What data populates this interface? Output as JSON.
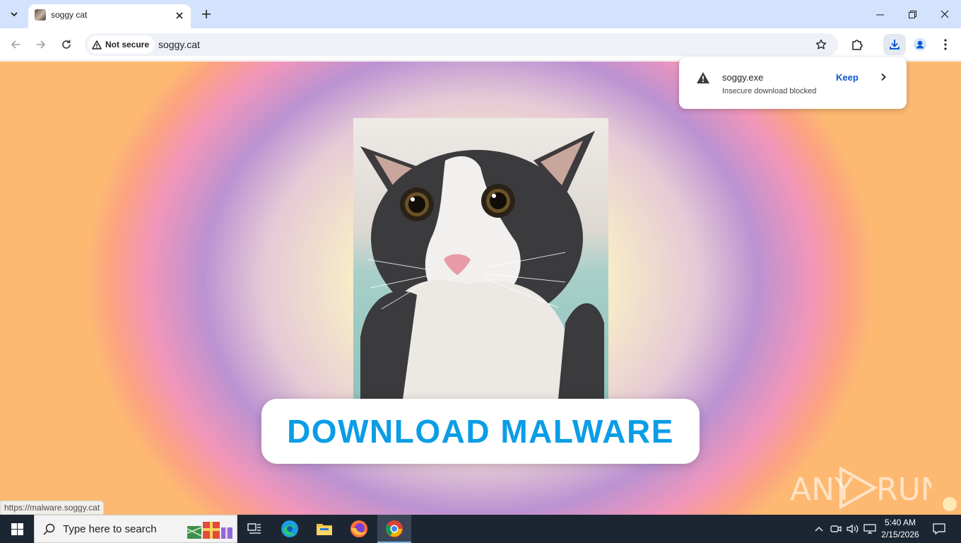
{
  "browser": {
    "tab": {
      "title": "soggy cat"
    },
    "toolbar": {
      "security_chip": "Not secure",
      "url": "soggy.cat"
    },
    "download_bubble": {
      "file_name": "soggy.exe",
      "status": "Insecure download blocked",
      "keep_label": "Keep"
    }
  },
  "page": {
    "cta_label": "DOWNLOAD MALWARE",
    "hover_status_url": "https://malware.soggy.cat",
    "watermark": "ANY RUN"
  },
  "taskbar": {
    "search_placeholder": "Type here to search",
    "clock_time": "5:40 AM",
    "clock_date": "2/15/2026"
  },
  "colors": {
    "tabstrip_bg": "#d3e3fd",
    "accent": "#0b57d0",
    "cta_text": "#0b9de6",
    "taskbar_bg": "#1c2633"
  }
}
